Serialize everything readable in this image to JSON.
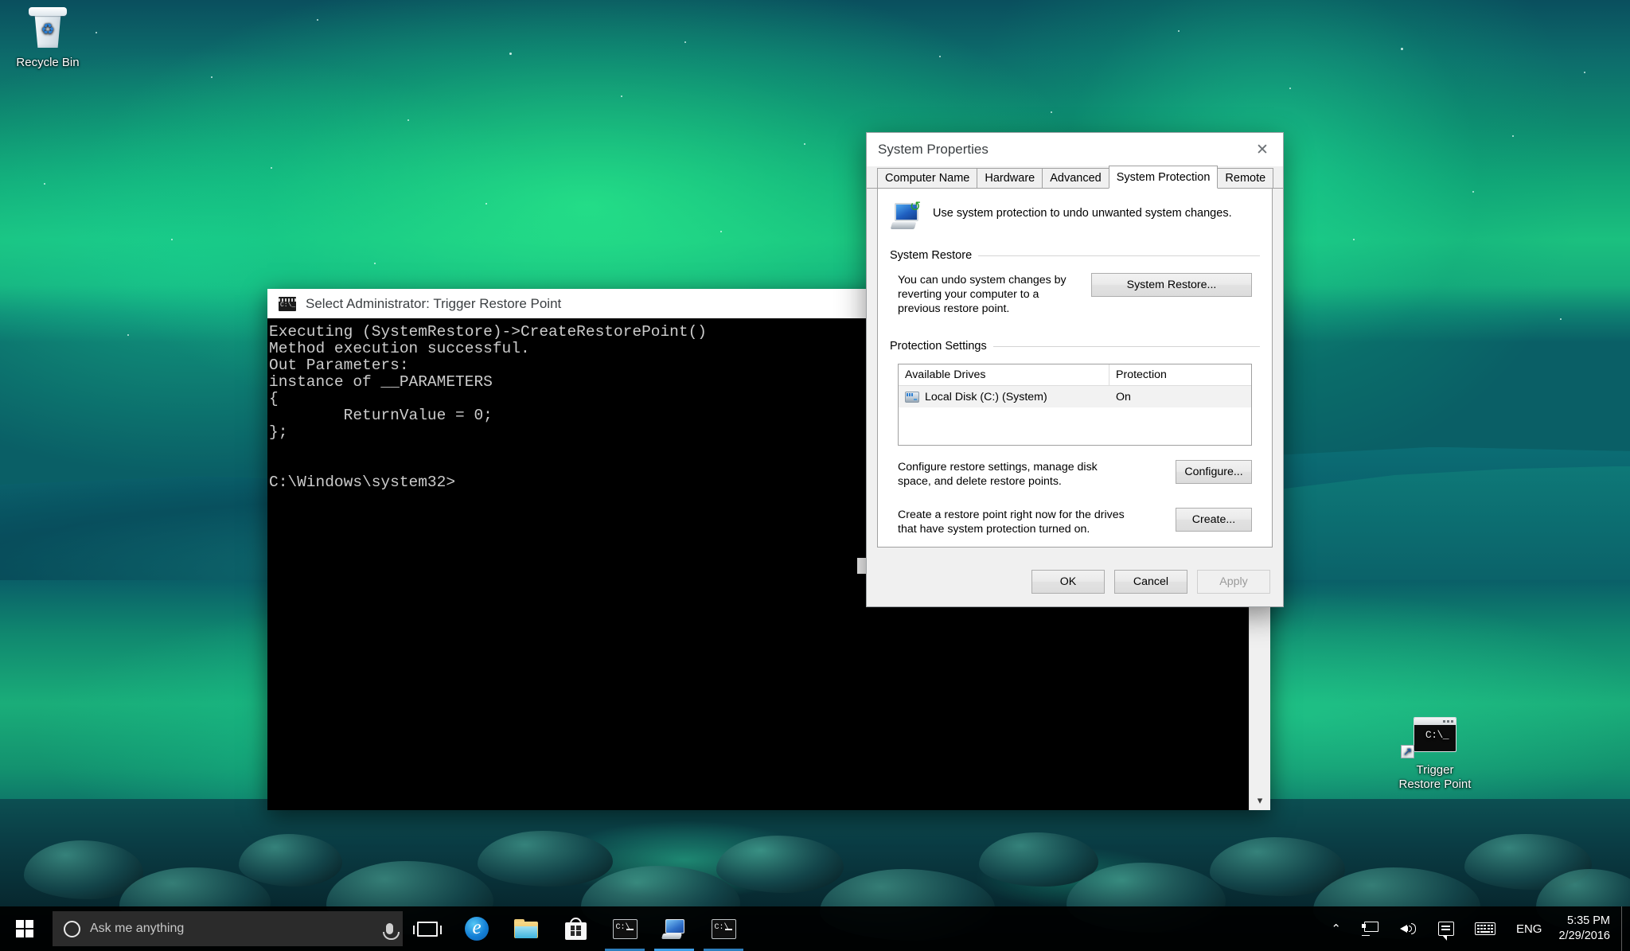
{
  "desktop": {
    "icons": [
      {
        "name": "recycle-bin",
        "label": "Recycle Bin",
        "icon": "recycle-bin-icon"
      },
      {
        "name": "trigger-restore-point",
        "label_line1": "Trigger",
        "label_line2": "Restore Point",
        "icon": "command-prompt-shortcut-icon"
      }
    ]
  },
  "cmd_window": {
    "title": "Select Administrator: Trigger Restore Point",
    "icon": "command-prompt-icon",
    "console_text": "Executing (SystemRestore)->CreateRestorePoint()\nMethod execution successful.\nOut Parameters:\ninstance of __PARAMETERS\n{\n        ReturnValue = 0;\n};\n\n\nC:\\Windows\\system32>",
    "scrollbar_down_glyph": "▾"
  },
  "system_properties": {
    "title": "System Properties",
    "close_label": "✕",
    "tabs": [
      {
        "label": "Computer Name",
        "active": false
      },
      {
        "label": "Hardware",
        "active": false
      },
      {
        "label": "Advanced",
        "active": false
      },
      {
        "label": "System Protection",
        "active": true
      },
      {
        "label": "Remote",
        "active": false
      }
    ],
    "header_text": "Use system protection to undo unwanted system changes.",
    "system_restore": {
      "group_title": "System Restore",
      "description": "You can undo system changes by reverting your computer to a previous restore point.",
      "button_label": "System Restore..."
    },
    "protection_settings": {
      "group_title": "Protection Settings",
      "columns": [
        "Available Drives",
        "Protection"
      ],
      "rows": [
        {
          "drive": "Local Disk (C:) (System)",
          "protection": "On"
        }
      ],
      "configure_description": "Configure restore settings, manage disk space, and delete restore points.",
      "configure_button": "Configure...",
      "create_description": "Create a restore point right now for the drives that have system protection turned on.",
      "create_button": "Create..."
    },
    "footer_buttons": {
      "ok": "OK",
      "cancel": "Cancel",
      "apply": "Apply"
    }
  },
  "taskbar": {
    "start_label": "Start",
    "search_placeholder": "Ask me anything",
    "cortana_icon": "cortana-circle-icon",
    "mic_icon": "microphone-icon",
    "buttons": [
      {
        "name": "task-view",
        "icon": "task-view-icon"
      },
      {
        "name": "microsoft-edge",
        "icon": "edge-icon"
      },
      {
        "name": "file-explorer",
        "icon": "folder-icon"
      },
      {
        "name": "microsoft-store",
        "icon": "store-icon"
      },
      {
        "name": "command-prompt-1",
        "icon": "command-prompt-icon"
      },
      {
        "name": "system-properties",
        "icon": "system-properties-icon"
      },
      {
        "name": "command-prompt-2",
        "icon": "command-prompt-icon"
      }
    ],
    "tray": {
      "show_hidden_icons": "⌃",
      "network_icon": "network-icon",
      "volume_icon": "volume-icon",
      "action_center_icon": "action-center-icon",
      "keyboard_icon": "touch-keyboard-icon",
      "language": "ENG",
      "time": "5:35 PM",
      "date": "2/29/2016"
    }
  }
}
